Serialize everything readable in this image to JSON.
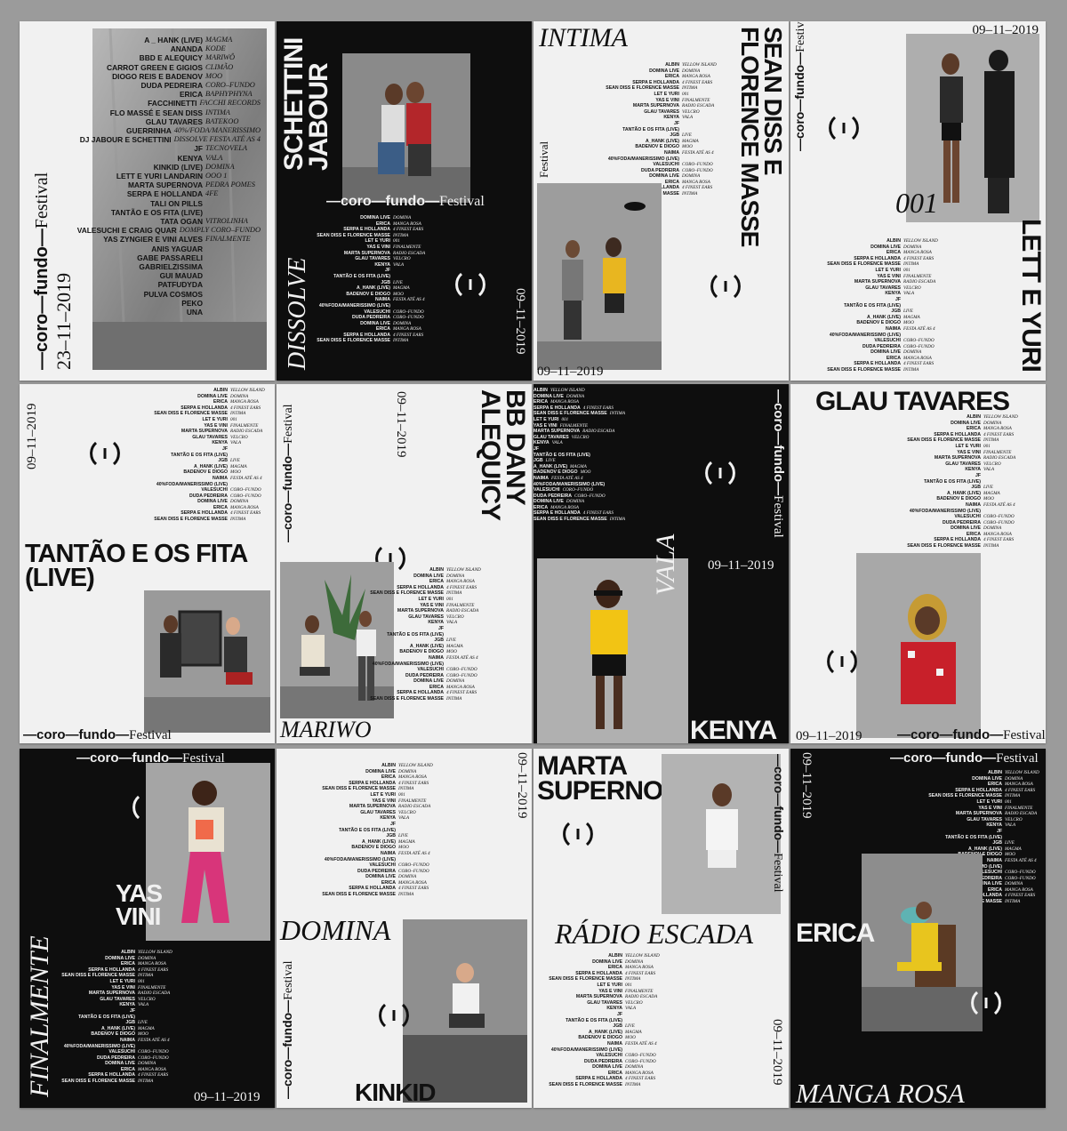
{
  "festival": {
    "name": "—coro—fundo—",
    "suffix": "Festival"
  },
  "dates": {
    "main": "09–11–2019",
    "first": "23–11–2019"
  },
  "lineup_full": [
    {
      "a": "A _ HANK (LIVE)",
      "v": "MAGMA"
    },
    {
      "a": "ANANDA",
      "v": "KODE"
    },
    {
      "a": "BBD E ALEQUICY",
      "v": "MARIWÔ"
    },
    {
      "a": "CARROT GREEN E GIGIOS",
      "v": "CLIMÃO"
    },
    {
      "a": "DIOGO REIS E BADENOV",
      "v": "MOO"
    },
    {
      "a": "DUDA PEDREIRA",
      "v": "CORO–FUNDO"
    },
    {
      "a": "ERICA",
      "v": "BAPHYPHYNA"
    },
    {
      "a": "FACCHINETTI",
      "v": "FACCHI RECORDS"
    },
    {
      "a": "FLO MASSÉ E SEAN DISS",
      "v": "INTIMA"
    },
    {
      "a": "GLAU TAVARES",
      "v": "BATEKOO"
    },
    {
      "a": "GUERRINHA",
      "v": "40%/FODA/MANERISSIMO"
    },
    {
      "a": "DJ JABOUR E SCHETTINI",
      "v": "DISSOLVE FESTA ATÉ AS 4"
    },
    {
      "a": "JF",
      "v": "TECNOVELA"
    },
    {
      "a": "KENYA",
      "v": "VALA"
    },
    {
      "a": "KINKID (LIVE)",
      "v": "DOMINA"
    },
    {
      "a": "LETT E YURI LANDARIN",
      "v": "OOO 1"
    },
    {
      "a": "MARTA SUPERNOVA",
      "v": "PEDRA POMES"
    },
    {
      "a": "SERPA E HOLLANDA",
      "v": "4FE"
    },
    {
      "a": "TALI ON PILLS",
      "v": ""
    },
    {
      "a": "TANTÃO E OS FITA (LIVE)",
      "v": ""
    },
    {
      "a": "TATA OGAN",
      "v": "VITROLINHA"
    },
    {
      "a": "VALESUCHI E CRAIG QUAR",
      "v": "DOMPLY CORO–FUNDO"
    },
    {
      "a": "YAS ZYNGIER E VINI ALVES",
      "v": "FINALMENTE"
    },
    {
      "a": "ANIS YAGUAR",
      "v": ""
    },
    {
      "a": "GABE PASSARELI",
      "v": ""
    },
    {
      "a": "GABRIELZISSIMA",
      "v": ""
    },
    {
      "a": "GUI MAUAD",
      "v": ""
    },
    {
      "a": "PATFUDYDA",
      "v": ""
    },
    {
      "a": "PULVA COSMOS",
      "v": ""
    },
    {
      "a": "PEKO",
      "v": ""
    },
    {
      "a": "UNA",
      "v": ""
    }
  ],
  "lineup": [
    {
      "a": "ALBIN",
      "v": "YELLOW ISLAND"
    },
    {
      "a": "DOMINA LIVE",
      "v": "DOMINA"
    },
    {
      "a": "ERICA",
      "v": "MANGA ROSA"
    },
    {
      "a": "SERPA E HOLLANDA",
      "v": "4 FINEST EARS"
    },
    {
      "a": "SEAN DISS E FLORENCE MASSE",
      "v": "INTIMA"
    },
    {
      "a": "LET E YURI",
      "v": "001"
    },
    {
      "a": "YAS E VINI",
      "v": "FINALMENTE"
    },
    {
      "a": "MARTA SUPERNOVA",
      "v": "RADIO ESCADA"
    },
    {
      "a": "GLAU TAVARES",
      "v": "VELCRO"
    },
    {
      "a": "KENYA",
      "v": "VALA"
    },
    {
      "a": "JF",
      "v": ""
    },
    {
      "a": "TANTÃO E OS FITA (LIVE)",
      "v": ""
    },
    {
      "a": "JGB",
      "v": "LIVE"
    },
    {
      "a": "A_HANK (LIVE)",
      "v": "MAGMA"
    },
    {
      "a": "BADENOV E DIOGO",
      "v": "MOO"
    },
    {
      "a": "NAIMA",
      "v": "FESTA ATÉ AS 4"
    },
    {
      "a": "40%FODA/MANERISSIMO (LIVE)",
      "v": ""
    },
    {
      "a": "VALESUCHI",
      "v": "CORO–FUNDO"
    },
    {
      "a": "DUDA PEDREIRA",
      "v": "CORO–FUNDO"
    },
    {
      "a": "DOMINA LIVE",
      "v": "DOMINA"
    },
    {
      "a": "ERICA",
      "v": "MANGA ROSA"
    },
    {
      "a": "SERPA E HOLLANDA",
      "v": "4 FINEST EARS"
    },
    {
      "a": "SEAN DISS E FLORENCE MASSE",
      "v": "INTIMA"
    }
  ],
  "lineup_short": [
    {
      "a": "DOMINA LIVE",
      "v": "DOMINA"
    },
    {
      "a": "ERICA",
      "v": "MANGA ROSA"
    },
    {
      "a": "SERPA E HOLLANDA",
      "v": "4 FINEST EARS"
    },
    {
      "a": "SEAN DISS E FLORENCE MASSE",
      "v": "INTIMA"
    },
    {
      "a": "LET E YURI",
      "v": "001"
    },
    {
      "a": "YAS E VINI",
      "v": "FINALMENTE"
    },
    {
      "a": "MARTA SUPERNOVA",
      "v": "RADIO ESCADA"
    },
    {
      "a": "GLAU TAVARES",
      "v": "VELCRO"
    },
    {
      "a": "KENYA",
      "v": "VALA"
    },
    {
      "a": "JF",
      "v": ""
    },
    {
      "a": "TANTÃO E OS FITA (LIVE)",
      "v": ""
    },
    {
      "a": "JGB",
      "v": "LIVE"
    },
    {
      "a": "A_HANK (LIVE)",
      "v": "MAGMA"
    },
    {
      "a": "BADENOV E DIOGO",
      "v": "MOO"
    },
    {
      "a": "NAIMA",
      "v": "FESTA ATÉ AS 4"
    },
    {
      "a": "40%FODA/MANERISSIMO (LIVE)",
      "v": ""
    },
    {
      "a": "VALESUCHI",
      "v": "CORO–FUNDO"
    },
    {
      "a": "DUDA PEDREIRA",
      "v": "CORO–FUNDO"
    },
    {
      "a": "DOMINA LIVE",
      "v": "DOMINA"
    },
    {
      "a": "ERICA",
      "v": "MANGA ROSA"
    },
    {
      "a": "SERPA E HOLLANDA",
      "v": "4 FINEST EARS"
    },
    {
      "a": "SEAN DISS E FLORENCE MASSE",
      "v": "INTIMA"
    }
  ],
  "posters": {
    "p2": {
      "title": "SCHETTINI JABOUR",
      "party": "DISSOLVE"
    },
    "p3": {
      "party": "INTIMA",
      "title": "SEAN DISS E FLORENCE MASSE"
    },
    "p4": {
      "party": "001",
      "title": "LETT E YURI"
    },
    "p5": {
      "title": "TANTÃO E OS FITA (LIVE)"
    },
    "p6": {
      "title": "BB DANY ALEQUICY",
      "party": "MARIWO"
    },
    "p7": {
      "party": "VALA",
      "title": "KENYA"
    },
    "p8": {
      "title": "GLAU TAVARES"
    },
    "p9": {
      "title": "YAS VINI",
      "party": "FINALMENTE"
    },
    "p10": {
      "party": "DOMINA",
      "title": "KINKID"
    },
    "p11": {
      "title": "MARTA SUPERNOVA",
      "party": "RÁDIO ESCADA"
    },
    "p12": {
      "title": "ERICA",
      "party": "MANGA ROSA"
    }
  },
  "colors": {
    "paper": "#f1f1f1",
    "ink": "#0e0e0e",
    "background": "#9b9b9b"
  }
}
